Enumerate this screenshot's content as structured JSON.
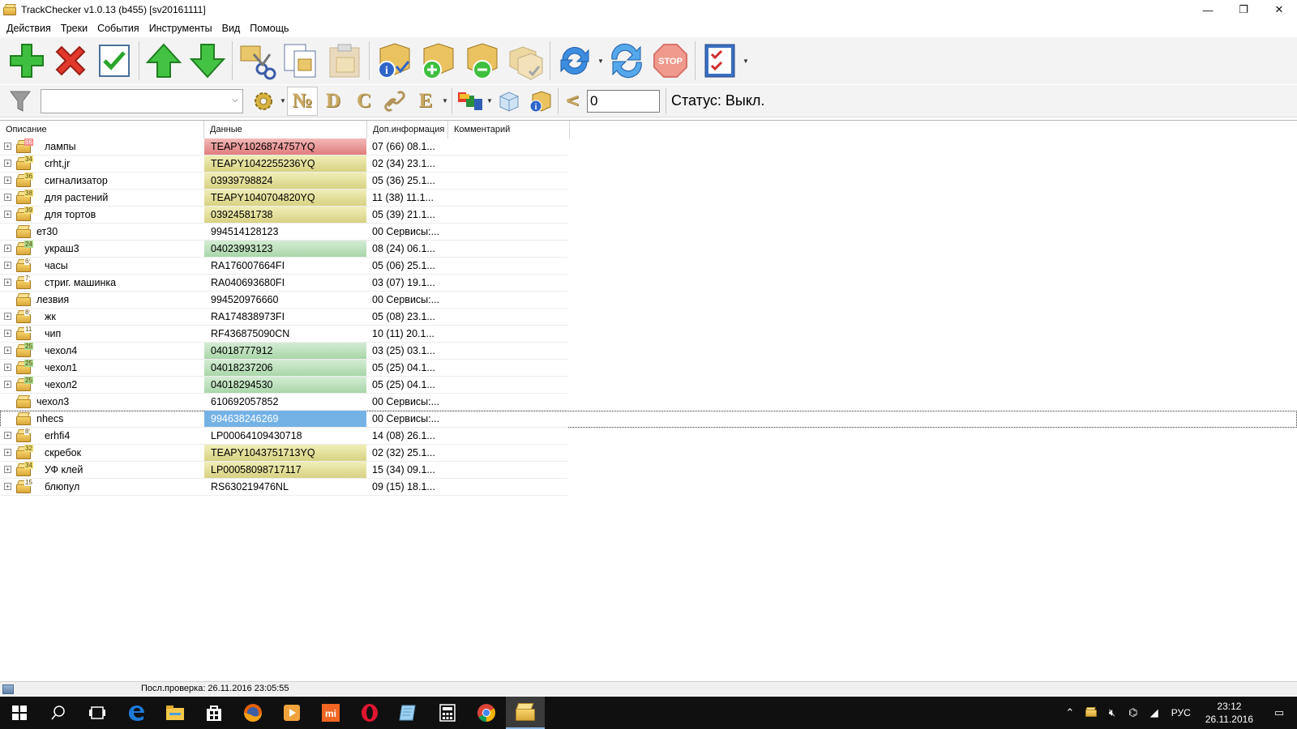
{
  "window": {
    "title": "TrackChecker v1.0.13 (b455)  [sv20161111]",
    "minimize": "—",
    "restore": "❐",
    "close": "✕"
  },
  "menu": [
    "Действия",
    "Треки",
    "События",
    "Инструменты",
    "Вид",
    "Помощь"
  ],
  "toolbar1_icons": [
    "add-icon",
    "delete-icon",
    "check-icon",
    "up-arrow-icon",
    "down-arrow-icon",
    "cut-icon",
    "copy-icon",
    "paste-icon",
    "package-info-icon",
    "package-add-icon",
    "package-remove-icon",
    "packages-icon",
    "refresh-icon",
    "refresh-all-icon",
    "stop-icon",
    "checklist-icon"
  ],
  "toolbar2": {
    "filter_value": "",
    "letter_buttons": [
      "№",
      "D",
      "C",
      "E"
    ],
    "count_value": "0",
    "status": "Статус: Выкл.",
    "less_than": "<",
    "stop_label": "STOP"
  },
  "columns": [
    "Описание",
    "Данные",
    "Доп.информация",
    "Комментарий"
  ],
  "rows": [
    {
      "expand": true,
      "badge": "66",
      "badge_color": "red",
      "desc": "лампы",
      "data": "TEAPY1026874757YQ",
      "color": "red",
      "info": "07 (66) 08.1..."
    },
    {
      "expand": true,
      "badge": "34",
      "badge_color": "yellow",
      "desc": "crht,jr",
      "data": "TEAPY1042255236YQ",
      "color": "yellow",
      "info": "02 (34) 23.1..."
    },
    {
      "expand": true,
      "badge": "36",
      "badge_color": "yellow",
      "desc": "сигнализатор",
      "data": "03939798824",
      "color": "yellow",
      "info": "05 (36) 25.1..."
    },
    {
      "expand": true,
      "badge": "38",
      "badge_color": "yellow",
      "desc": "для растений",
      "data": "TEAPY1040704820YQ",
      "color": "yellow",
      "info": "11 (38) 11.1..."
    },
    {
      "expand": true,
      "badge": "39",
      "badge_color": "yellow",
      "desc": "для тортов",
      "data": "03924581738",
      "color": "yellow",
      "info": "05 (39) 21.1..."
    },
    {
      "expand": false,
      "badge": "",
      "badge_color": "",
      "desc": "ет30",
      "data": "994514128123",
      "color": "",
      "info": "00 Сервисы:..."
    },
    {
      "expand": true,
      "badge": "24",
      "badge_color": "green",
      "desc": "украш3",
      "data": "04023993123",
      "color": "green",
      "info": "08 (24) 06.1..."
    },
    {
      "expand": true,
      "badge": "6",
      "badge_color": "plain",
      "desc": "часы",
      "data": "RA176007664FI",
      "color": "",
      "info": "05 (06) 25.1..."
    },
    {
      "expand": true,
      "badge": "7",
      "badge_color": "plain",
      "desc": "стриг. машинка",
      "data": "RA040693680FI",
      "color": "",
      "info": "03 (07) 19.1..."
    },
    {
      "expand": false,
      "badge": "",
      "badge_color": "",
      "desc": "лезвия",
      "data": "994520976660",
      "color": "",
      "info": "00 Сервисы:..."
    },
    {
      "expand": true,
      "badge": "8",
      "badge_color": "plain",
      "desc": "жк",
      "data": "RA174838973FI",
      "color": "",
      "info": "05 (08) 23.1..."
    },
    {
      "expand": true,
      "badge": "11",
      "badge_color": "plain",
      "desc": "чип",
      "data": "RF436875090CN",
      "color": "",
      "info": "10 (11) 20.1..."
    },
    {
      "expand": true,
      "badge": "25",
      "badge_color": "green",
      "desc": "чехол4",
      "data": "04018777912",
      "color": "green",
      "info": "03 (25) 03.1..."
    },
    {
      "expand": true,
      "badge": "25",
      "badge_color": "green",
      "desc": "чехол1",
      "data": "04018237206",
      "color": "green",
      "info": "05 (25) 04.1..."
    },
    {
      "expand": true,
      "badge": "25",
      "badge_color": "green",
      "desc": "чехол2",
      "data": "04018294530",
      "color": "green",
      "info": "05 (25) 04.1..."
    },
    {
      "expand": false,
      "badge": "",
      "badge_color": "",
      "desc": "чехол3",
      "data": "610692057852",
      "color": "",
      "info": "00 Сервисы:..."
    },
    {
      "expand": false,
      "badge": "",
      "badge_color": "",
      "desc": "nhecs",
      "data": "994638246269",
      "color": "selected",
      "info": "00 Сервисы:...",
      "focused": true
    },
    {
      "expand": true,
      "badge": "8",
      "badge_color": "plain",
      "desc": "erhfi4",
      "data": "LP00064109430718",
      "color": "",
      "info": "14 (08) 26.1..."
    },
    {
      "expand": true,
      "badge": "32",
      "badge_color": "yellow",
      "desc": "скребок",
      "data": "TEAPY1043751713YQ",
      "color": "yellow",
      "info": "02 (32) 25.1..."
    },
    {
      "expand": true,
      "badge": "34",
      "badge_color": "yellow",
      "desc": "УФ клей",
      "data": "LP00058098717117",
      "color": "yellow",
      "info": "15 (34) 09.1..."
    },
    {
      "expand": true,
      "badge": "15",
      "badge_color": "plain",
      "desc": "блюпул",
      "data": "RS630219476NL",
      "color": "",
      "info": "09 (15) 18.1..."
    }
  ],
  "statusbar": {
    "last_check": "Посл.проверка: 26.11.2016 23:05:55"
  },
  "taskbar": {
    "apps": [
      "windows-start-icon",
      "search-icon",
      "task-view-icon",
      "edge-icon",
      "explorer-icon",
      "store-icon",
      "firefox-icon",
      "media-player-icon",
      "mi-icon",
      "opera-icon",
      "notepad-icon",
      "calculator-icon",
      "chrome-icon",
      "trackchecker-icon"
    ],
    "lang": "РУС",
    "time": "23:12",
    "date": "26.11.2016"
  },
  "colors": {
    "row_red": "#e07c7c",
    "row_yellow": "#d8d282",
    "row_green": "#a9d6a9",
    "row_selected": "#74b2e6"
  }
}
